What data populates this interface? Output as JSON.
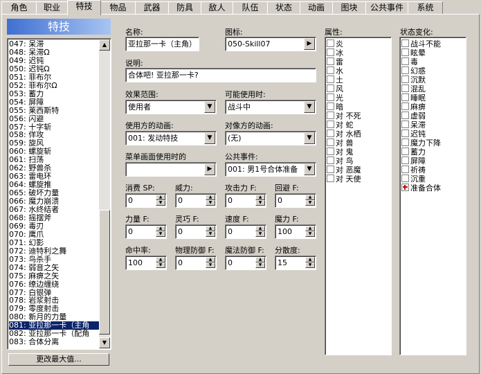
{
  "tabs": [
    "角色",
    "职业",
    "特技",
    "物品",
    "武器",
    "防具",
    "敌人",
    "队伍",
    "状态",
    "动画",
    "图块",
    "公共事件",
    "系统"
  ],
  "list": {
    "title": "特技",
    "items": [
      "047: 呆滞",
      "048: 呆滞Ω",
      "049: 迟钝",
      "050: 迟钝Ω",
      "051: 菲布尔",
      "052: 菲布尔Ω",
      "053: 蓄力",
      "054: 屏障",
      "055: 莱西斯特",
      "056: 闪避",
      "057: 十字斩",
      "058: 佯攻",
      "059: 旋风",
      "060: 螺旋斩",
      "061: 扫荡",
      "062: 野兽杀",
      "063: 雷电环",
      "064: 螺旋推",
      "065: 破坏力量",
      "066: 魔力崩溃",
      "067: 水终结者",
      "068: 摇摆斧",
      "069: 毒刃",
      "070: 鹰爪",
      "071: 幻影",
      "072: 迪特利之舞",
      "073: 鸟杀手",
      "074: 弱音之矢",
      "075: 麻痹之矢",
      "076: 缭边缠绕",
      "077: 白银弹",
      "078: 岩浆射击",
      "079: 零度射击",
      "080: 新月的力量",
      "081: 亚拉那一卡（主角",
      "082: 亚拉那一卡（配角",
      "083: 合体分离"
    ],
    "selected_index": 34,
    "max_button": "更改最大值..."
  },
  "form": {
    "name_label": "名称:",
    "name_value": "亚拉那一卡（主角）",
    "icon_label": "图标:",
    "icon_value": "050-Skill07",
    "desc_label": "说明:",
    "desc_value": "合体吧! 亚拉那一卡?",
    "scope_label": "效果范围:",
    "scope_value": "使用者",
    "occasion_label": "可能使用时:",
    "occasion_value": "战斗中",
    "user_anim_label": "使用方的动画:",
    "user_anim_value": "001: 发动特技",
    "target_anim_label": "对像方的动画:",
    "target_anim_value": "(无)",
    "menu_se_label": "菜单画面使用时的",
    "menu_se_value": "",
    "common_event_label": "公共事件:",
    "common_event_value": "001: 男1号合体准备",
    "sp_label": "消费 SP:",
    "sp_value": "0",
    "power_label": "威力:",
    "power_value": "0",
    "atkf_label": "攻击力 F:",
    "atkf_value": "0",
    "evaf_label": "回避 F:",
    "evaf_value": "0",
    "strf_label": "力量 F:",
    "strf_value": "0",
    "dexf_label": "灵巧 F:",
    "dexf_value": "0",
    "agif_label": "速度 F:",
    "agif_value": "0",
    "intf_label": "魔力 F:",
    "intf_value": "100",
    "hit_label": "命中率:",
    "hit_value": "100",
    "pdef_label": "物理防御 F:",
    "pdef_value": "0",
    "mdef_label": "魔法防御 F:",
    "mdef_value": "0",
    "variance_label": "分散度:",
    "variance_value": "15"
  },
  "attributes": {
    "label": "属性:",
    "items": [
      "炎",
      "冰",
      "雷",
      "水",
      "土",
      "风",
      "光",
      "暗",
      "对 不死",
      "对 蛇",
      "对 水栖",
      "对 兽",
      "对 鬼",
      "对 鸟",
      "对 恶魔",
      "对 天使"
    ]
  },
  "states": {
    "label": "状态变化:",
    "items": [
      "战斗不能",
      "眩晕",
      "毒",
      "幻惑",
      "沉默",
      "混乱",
      "睡眠",
      "麻痹",
      "虚弱",
      "呆滞",
      "迟钝",
      "魔力下降",
      "蓄力",
      "屏障",
      "祈祷",
      "沉重",
      "准备合体"
    ],
    "plus_index": 16
  }
}
